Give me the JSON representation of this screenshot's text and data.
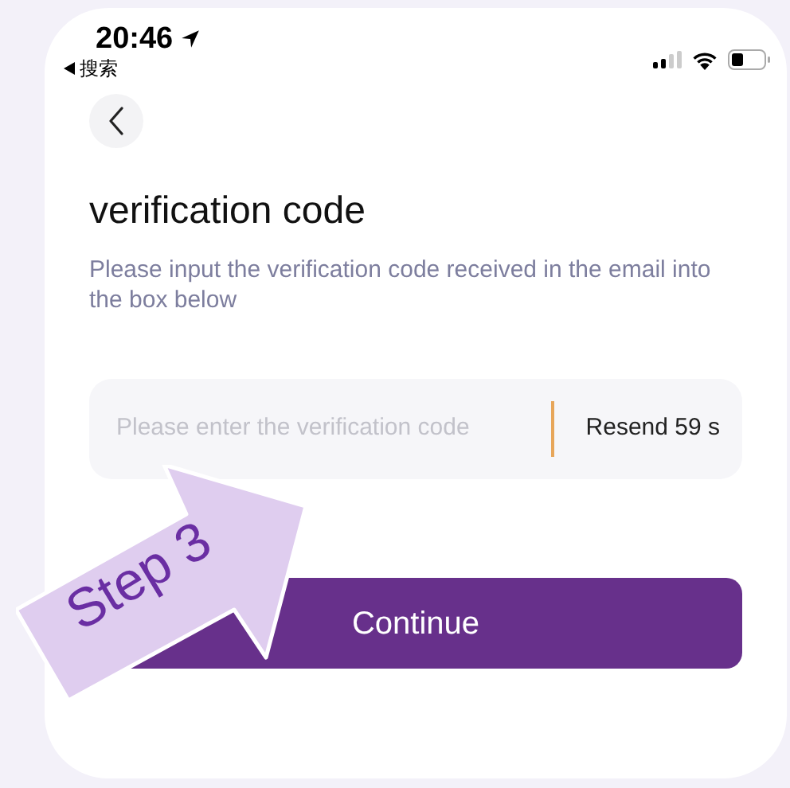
{
  "status_bar": {
    "time": "20:46",
    "back_app": "搜索"
  },
  "header": {
    "title": "verification code",
    "subtitle": "Please input the verification code received in the email into the box below"
  },
  "code_field": {
    "placeholder": "Please enter the verification code",
    "resend": "Resend 59 s"
  },
  "continue_button": {
    "label": "Continue"
  },
  "annotation": {
    "label": "Step 3"
  }
}
